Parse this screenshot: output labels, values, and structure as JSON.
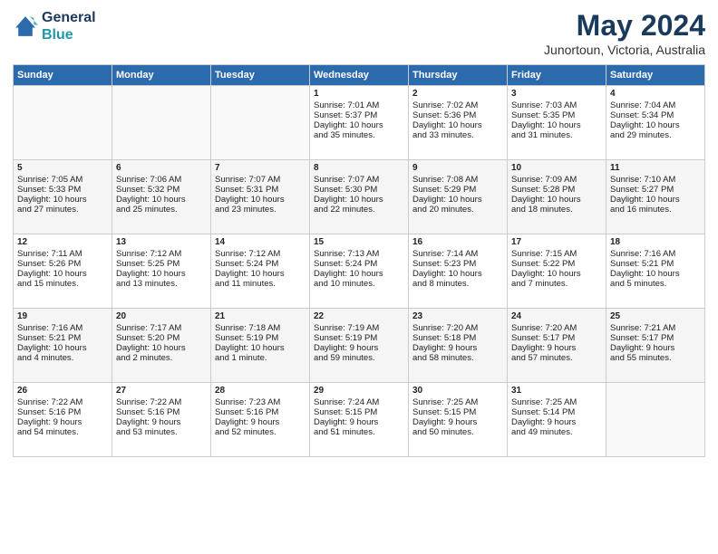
{
  "logo": {
    "line1": "General",
    "line2": "Blue"
  },
  "title": "May 2024",
  "subtitle": "Junortoun, Victoria, Australia",
  "days_header": [
    "Sunday",
    "Monday",
    "Tuesday",
    "Wednesday",
    "Thursday",
    "Friday",
    "Saturday"
  ],
  "weeks": [
    [
      {
        "num": "",
        "content": ""
      },
      {
        "num": "",
        "content": ""
      },
      {
        "num": "",
        "content": ""
      },
      {
        "num": "1",
        "content": "Sunrise: 7:01 AM\nSunset: 5:37 PM\nDaylight: 10 hours\nand 35 minutes."
      },
      {
        "num": "2",
        "content": "Sunrise: 7:02 AM\nSunset: 5:36 PM\nDaylight: 10 hours\nand 33 minutes."
      },
      {
        "num": "3",
        "content": "Sunrise: 7:03 AM\nSunset: 5:35 PM\nDaylight: 10 hours\nand 31 minutes."
      },
      {
        "num": "4",
        "content": "Sunrise: 7:04 AM\nSunset: 5:34 PM\nDaylight: 10 hours\nand 29 minutes."
      }
    ],
    [
      {
        "num": "5",
        "content": "Sunrise: 7:05 AM\nSunset: 5:33 PM\nDaylight: 10 hours\nand 27 minutes."
      },
      {
        "num": "6",
        "content": "Sunrise: 7:06 AM\nSunset: 5:32 PM\nDaylight: 10 hours\nand 25 minutes."
      },
      {
        "num": "7",
        "content": "Sunrise: 7:07 AM\nSunset: 5:31 PM\nDaylight: 10 hours\nand 23 minutes."
      },
      {
        "num": "8",
        "content": "Sunrise: 7:07 AM\nSunset: 5:30 PM\nDaylight: 10 hours\nand 22 minutes."
      },
      {
        "num": "9",
        "content": "Sunrise: 7:08 AM\nSunset: 5:29 PM\nDaylight: 10 hours\nand 20 minutes."
      },
      {
        "num": "10",
        "content": "Sunrise: 7:09 AM\nSunset: 5:28 PM\nDaylight: 10 hours\nand 18 minutes."
      },
      {
        "num": "11",
        "content": "Sunrise: 7:10 AM\nSunset: 5:27 PM\nDaylight: 10 hours\nand 16 minutes."
      }
    ],
    [
      {
        "num": "12",
        "content": "Sunrise: 7:11 AM\nSunset: 5:26 PM\nDaylight: 10 hours\nand 15 minutes."
      },
      {
        "num": "13",
        "content": "Sunrise: 7:12 AM\nSunset: 5:25 PM\nDaylight: 10 hours\nand 13 minutes."
      },
      {
        "num": "14",
        "content": "Sunrise: 7:12 AM\nSunset: 5:24 PM\nDaylight: 10 hours\nand 11 minutes."
      },
      {
        "num": "15",
        "content": "Sunrise: 7:13 AM\nSunset: 5:24 PM\nDaylight: 10 hours\nand 10 minutes."
      },
      {
        "num": "16",
        "content": "Sunrise: 7:14 AM\nSunset: 5:23 PM\nDaylight: 10 hours\nand 8 minutes."
      },
      {
        "num": "17",
        "content": "Sunrise: 7:15 AM\nSunset: 5:22 PM\nDaylight: 10 hours\nand 7 minutes."
      },
      {
        "num": "18",
        "content": "Sunrise: 7:16 AM\nSunset: 5:21 PM\nDaylight: 10 hours\nand 5 minutes."
      }
    ],
    [
      {
        "num": "19",
        "content": "Sunrise: 7:16 AM\nSunset: 5:21 PM\nDaylight: 10 hours\nand 4 minutes."
      },
      {
        "num": "20",
        "content": "Sunrise: 7:17 AM\nSunset: 5:20 PM\nDaylight: 10 hours\nand 2 minutes."
      },
      {
        "num": "21",
        "content": "Sunrise: 7:18 AM\nSunset: 5:19 PM\nDaylight: 10 hours\nand 1 minute."
      },
      {
        "num": "22",
        "content": "Sunrise: 7:19 AM\nSunset: 5:19 PM\nDaylight: 9 hours\nand 59 minutes."
      },
      {
        "num": "23",
        "content": "Sunrise: 7:20 AM\nSunset: 5:18 PM\nDaylight: 9 hours\nand 58 minutes."
      },
      {
        "num": "24",
        "content": "Sunrise: 7:20 AM\nSunset: 5:17 PM\nDaylight: 9 hours\nand 57 minutes."
      },
      {
        "num": "25",
        "content": "Sunrise: 7:21 AM\nSunset: 5:17 PM\nDaylight: 9 hours\nand 55 minutes."
      }
    ],
    [
      {
        "num": "26",
        "content": "Sunrise: 7:22 AM\nSunset: 5:16 PM\nDaylight: 9 hours\nand 54 minutes."
      },
      {
        "num": "27",
        "content": "Sunrise: 7:22 AM\nSunset: 5:16 PM\nDaylight: 9 hours\nand 53 minutes."
      },
      {
        "num": "28",
        "content": "Sunrise: 7:23 AM\nSunset: 5:16 PM\nDaylight: 9 hours\nand 52 minutes."
      },
      {
        "num": "29",
        "content": "Sunrise: 7:24 AM\nSunset: 5:15 PM\nDaylight: 9 hours\nand 51 minutes."
      },
      {
        "num": "30",
        "content": "Sunrise: 7:25 AM\nSunset: 5:15 PM\nDaylight: 9 hours\nand 50 minutes."
      },
      {
        "num": "31",
        "content": "Sunrise: 7:25 AM\nSunset: 5:14 PM\nDaylight: 9 hours\nand 49 minutes."
      },
      {
        "num": "",
        "content": ""
      }
    ]
  ]
}
